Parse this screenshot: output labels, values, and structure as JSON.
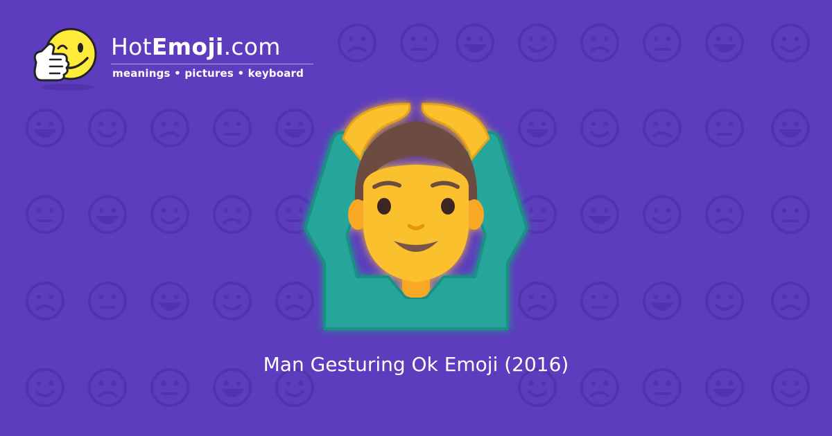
{
  "site": {
    "name_prefix": "Hot",
    "name_bold": "Emoji",
    "name_suffix": ".com",
    "tagline": "meanings • pictures • keyboard"
  },
  "hero": {
    "icon": "man-gesturing-ok-icon"
  },
  "caption": "Man Gesturing Ok Emoji (2016)",
  "colors": {
    "background": "#5d3dbe",
    "pattern": "#5233ad",
    "skin": "#fbc02d",
    "hair": "#6d4c41",
    "shirt": "#26a69a"
  }
}
